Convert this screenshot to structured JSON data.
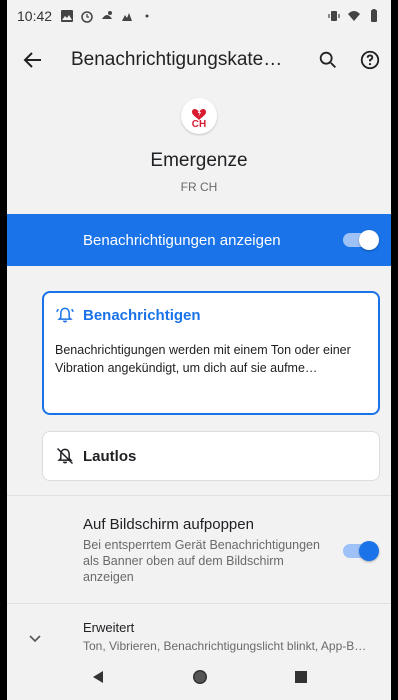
{
  "status_bar": {
    "time": "10:42",
    "icons": [
      "image-icon",
      "alarm-icon",
      "app-icon",
      "weather-icon",
      "dot-icon"
    ],
    "right_icons": [
      "vibrate-icon",
      "wifi-icon",
      "battery-icon"
    ]
  },
  "app_bar": {
    "title": "Benachrichtigungskate…",
    "back_icon": "arrow-back-icon",
    "search_icon": "search-icon",
    "help_icon": "help-icon"
  },
  "app": {
    "icon_text": "CH",
    "name": "Emergenze",
    "subtitle": "FR CH"
  },
  "master_toggle": {
    "label": "Benachrichtigungen anzeigen",
    "on": true
  },
  "options": {
    "alert": {
      "title": "Benachrichtigen",
      "description": "Benachrichtigungen werden mit einem Ton oder einer Vibration angekündigt, um dich auf sie aufme…",
      "selected": true
    },
    "silent": {
      "title": "Lautlos",
      "selected": false
    }
  },
  "popup": {
    "title": "Auf Bildschirm aufpoppen",
    "subtitle": "Bei entsperrtem Gerät Benachrichtigungen als Banner oben auf dem Bildschirm anzeigen",
    "on": true
  },
  "advanced": {
    "title": "Erweitert",
    "subtitle": "Ton, Vibrieren, Benachrichtigungslicht blinkt, App-B…"
  },
  "colors": {
    "accent": "#1a73e8",
    "background": "#f2f2f2"
  }
}
